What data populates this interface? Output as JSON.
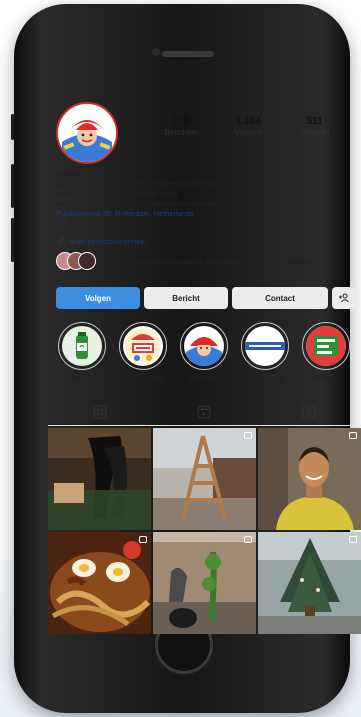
{
  "profile": {
    "stats": [
      {
        "value": "270",
        "label": "Berichten"
      },
      {
        "value": "1.104",
        "label": "Volgers"
      },
      {
        "value": "511",
        "label": "Volgend"
      }
    ],
    "name": "Opzoomer Mee",
    "bio_line1": "Opzoomer Mee helpt Rotterdammers bij het #opzoomeren: met je",
    "bio_line2": "buren zorgen voor een prettige straat",
    "bio_line3": "Administratieve afhandeling bewonersinitiatieven",
    "address": "Pupillonstraat 56, Rotterdam, Netherlands",
    "link": "linktr.ee/opzoomermee",
    "followed_prefix": "Gevolgd door ",
    "followed_names": "almamusinovic, mariapepe.resto",
    "followed_suffix": " en 2 anderen"
  },
  "buttons": {
    "follow": "Volgen",
    "message": "Bericht",
    "contact": "Contact"
  },
  "highlights": [
    {
      "label": "Water",
      "icon": "water-bottle-icon",
      "color": "#2f8f3a"
    },
    {
      "label": "Lief & Leed",
      "icon": "lief-en-leed-logo",
      "color": "#e23b3b"
    },
    {
      "label": "Over ons",
      "icon": "opzoomer-logo",
      "color": "#d62828"
    },
    {
      "label": "In de straat",
      "icon": "in-de-straat-banner",
      "color": "#2a5fb0"
    },
    {
      "label": "Schoon",
      "icon": "clean-street-icon",
      "color": "#2f8f3a"
    }
  ],
  "tabs": [
    {
      "name": "grid-icon",
      "active": true
    },
    {
      "name": "reels-icon",
      "active": false
    },
    {
      "name": "tagged-icon",
      "active": false
    }
  ],
  "posts": [
    {
      "name": "post-dance-photo",
      "reel": false
    },
    {
      "name": "post-wooden-tower-photo",
      "reel": true
    },
    {
      "name": "post-smiling-man-photo",
      "reel": true
    },
    {
      "name": "post-food-photo",
      "reel": true
    },
    {
      "name": "post-gardening-photo",
      "reel": true
    },
    {
      "name": "post-tree-photo",
      "reel": true
    }
  ]
}
